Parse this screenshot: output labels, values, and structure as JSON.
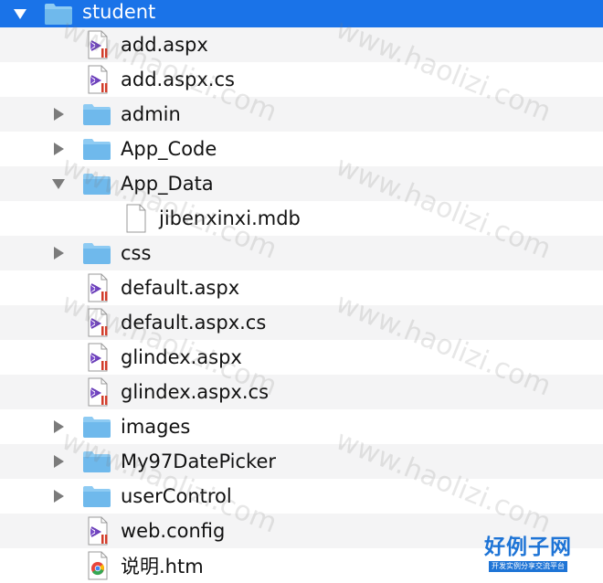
{
  "accent_color": "#1a73e8",
  "tree": {
    "root": {
      "label": "student",
      "expanded": true,
      "icon": "folder-icon"
    },
    "items": [
      {
        "label": "add.aspx",
        "type": "file",
        "icon": "visual-studio-file-icon",
        "depth": 1
      },
      {
        "label": "add.aspx.cs",
        "type": "file",
        "icon": "visual-studio-file-icon",
        "depth": 1
      },
      {
        "label": "admin",
        "type": "folder",
        "icon": "folder-icon",
        "expanded": false,
        "depth": 1
      },
      {
        "label": "App_Code",
        "type": "folder",
        "icon": "folder-icon",
        "expanded": false,
        "depth": 1
      },
      {
        "label": "App_Data",
        "type": "folder",
        "icon": "folder-icon",
        "expanded": true,
        "depth": 1
      },
      {
        "label": "jibenxinxi.mdb",
        "type": "file",
        "icon": "blank-document-icon",
        "depth": 2
      },
      {
        "label": "css",
        "type": "folder",
        "icon": "folder-icon",
        "expanded": false,
        "depth": 1
      },
      {
        "label": "default.aspx",
        "type": "file",
        "icon": "visual-studio-file-icon",
        "depth": 1
      },
      {
        "label": "default.aspx.cs",
        "type": "file",
        "icon": "visual-studio-file-icon",
        "depth": 1
      },
      {
        "label": "glindex.aspx",
        "type": "file",
        "icon": "visual-studio-file-icon",
        "depth": 1
      },
      {
        "label": "glindex.aspx.cs",
        "type": "file",
        "icon": "visual-studio-file-icon",
        "depth": 1
      },
      {
        "label": "images",
        "type": "folder",
        "icon": "folder-icon",
        "expanded": false,
        "depth": 1
      },
      {
        "label": "My97DatePicker",
        "type": "folder",
        "icon": "folder-icon",
        "expanded": false,
        "depth": 1
      },
      {
        "label": "userControl",
        "type": "folder",
        "icon": "folder-icon",
        "expanded": false,
        "depth": 1
      },
      {
        "label": "web.config",
        "type": "file",
        "icon": "visual-studio-file-icon",
        "depth": 1
      },
      {
        "label": "说明.htm",
        "type": "file",
        "icon": "chrome-html-icon",
        "depth": 1
      }
    ]
  },
  "watermark": {
    "text": "www.haolizi.com"
  },
  "brand": {
    "title": "好例子网",
    "subtitle": "开发实例分享交流平台"
  }
}
